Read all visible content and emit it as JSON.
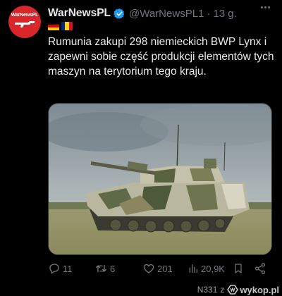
{
  "tweet": {
    "avatar": {
      "brand": "WarNewsPL"
    },
    "author_name": "WarNewsPL",
    "handle": "@WarNewsPL1",
    "separator": "·",
    "time": "13 g.",
    "flags": [
      "de-flag",
      "ro-flag"
    ],
    "text": "Rumunia zakupi 298 niemieckich BWP Lynx i zapewni sobie część produkcji elementów tych maszyn na terytorium tego kraju.",
    "media": {
      "icon": "tank-photo"
    }
  },
  "actions": {
    "replies": "11",
    "reposts": "6",
    "likes": "201",
    "views": "20,9K"
  },
  "watermark": {
    "user": "N331",
    "separator": "z",
    "site": "wykop.pl"
  },
  "colors": {
    "background": "#000000",
    "text": "#e7e9ea",
    "muted": "#71767b",
    "verified": "#1d9bf0",
    "avatar": "#d8262b"
  }
}
